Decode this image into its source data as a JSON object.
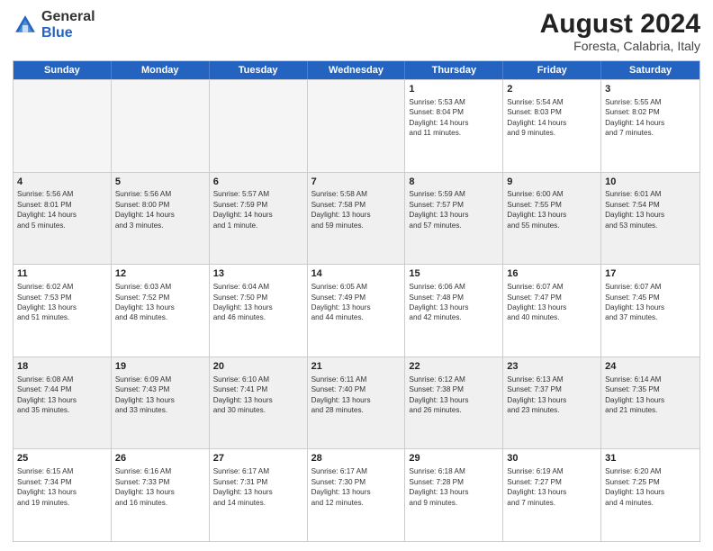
{
  "header": {
    "logo_general": "General",
    "logo_blue": "Blue",
    "title": "August 2024",
    "subtitle": "Foresta, Calabria, Italy"
  },
  "calendar": {
    "days_of_week": [
      "Sunday",
      "Monday",
      "Tuesday",
      "Wednesday",
      "Thursday",
      "Friday",
      "Saturday"
    ],
    "rows": [
      [
        {
          "day": "",
          "empty": true
        },
        {
          "day": "",
          "empty": true
        },
        {
          "day": "",
          "empty": true
        },
        {
          "day": "",
          "empty": true
        },
        {
          "day": "1",
          "lines": [
            "Sunrise: 5:53 AM",
            "Sunset: 8:04 PM",
            "Daylight: 14 hours",
            "and 11 minutes."
          ]
        },
        {
          "day": "2",
          "lines": [
            "Sunrise: 5:54 AM",
            "Sunset: 8:03 PM",
            "Daylight: 14 hours",
            "and 9 minutes."
          ]
        },
        {
          "day": "3",
          "lines": [
            "Sunrise: 5:55 AM",
            "Sunset: 8:02 PM",
            "Daylight: 14 hours",
            "and 7 minutes."
          ]
        }
      ],
      [
        {
          "day": "4",
          "lines": [
            "Sunrise: 5:56 AM",
            "Sunset: 8:01 PM",
            "Daylight: 14 hours",
            "and 5 minutes."
          ]
        },
        {
          "day": "5",
          "lines": [
            "Sunrise: 5:56 AM",
            "Sunset: 8:00 PM",
            "Daylight: 14 hours",
            "and 3 minutes."
          ]
        },
        {
          "day": "6",
          "lines": [
            "Sunrise: 5:57 AM",
            "Sunset: 7:59 PM",
            "Daylight: 14 hours",
            "and 1 minute."
          ]
        },
        {
          "day": "7",
          "lines": [
            "Sunrise: 5:58 AM",
            "Sunset: 7:58 PM",
            "Daylight: 13 hours",
            "and 59 minutes."
          ]
        },
        {
          "day": "8",
          "lines": [
            "Sunrise: 5:59 AM",
            "Sunset: 7:57 PM",
            "Daylight: 13 hours",
            "and 57 minutes."
          ]
        },
        {
          "day": "9",
          "lines": [
            "Sunrise: 6:00 AM",
            "Sunset: 7:55 PM",
            "Daylight: 13 hours",
            "and 55 minutes."
          ]
        },
        {
          "day": "10",
          "lines": [
            "Sunrise: 6:01 AM",
            "Sunset: 7:54 PM",
            "Daylight: 13 hours",
            "and 53 minutes."
          ]
        }
      ],
      [
        {
          "day": "11",
          "lines": [
            "Sunrise: 6:02 AM",
            "Sunset: 7:53 PM",
            "Daylight: 13 hours",
            "and 51 minutes."
          ]
        },
        {
          "day": "12",
          "lines": [
            "Sunrise: 6:03 AM",
            "Sunset: 7:52 PM",
            "Daylight: 13 hours",
            "and 48 minutes."
          ]
        },
        {
          "day": "13",
          "lines": [
            "Sunrise: 6:04 AM",
            "Sunset: 7:50 PM",
            "Daylight: 13 hours",
            "and 46 minutes."
          ]
        },
        {
          "day": "14",
          "lines": [
            "Sunrise: 6:05 AM",
            "Sunset: 7:49 PM",
            "Daylight: 13 hours",
            "and 44 minutes."
          ]
        },
        {
          "day": "15",
          "lines": [
            "Sunrise: 6:06 AM",
            "Sunset: 7:48 PM",
            "Daylight: 13 hours",
            "and 42 minutes."
          ]
        },
        {
          "day": "16",
          "lines": [
            "Sunrise: 6:07 AM",
            "Sunset: 7:47 PM",
            "Daylight: 13 hours",
            "and 40 minutes."
          ]
        },
        {
          "day": "17",
          "lines": [
            "Sunrise: 6:07 AM",
            "Sunset: 7:45 PM",
            "Daylight: 13 hours",
            "and 37 minutes."
          ]
        }
      ],
      [
        {
          "day": "18",
          "lines": [
            "Sunrise: 6:08 AM",
            "Sunset: 7:44 PM",
            "Daylight: 13 hours",
            "and 35 minutes."
          ]
        },
        {
          "day": "19",
          "lines": [
            "Sunrise: 6:09 AM",
            "Sunset: 7:43 PM",
            "Daylight: 13 hours",
            "and 33 minutes."
          ]
        },
        {
          "day": "20",
          "lines": [
            "Sunrise: 6:10 AM",
            "Sunset: 7:41 PM",
            "Daylight: 13 hours",
            "and 30 minutes."
          ]
        },
        {
          "day": "21",
          "lines": [
            "Sunrise: 6:11 AM",
            "Sunset: 7:40 PM",
            "Daylight: 13 hours",
            "and 28 minutes."
          ]
        },
        {
          "day": "22",
          "lines": [
            "Sunrise: 6:12 AM",
            "Sunset: 7:38 PM",
            "Daylight: 13 hours",
            "and 26 minutes."
          ]
        },
        {
          "day": "23",
          "lines": [
            "Sunrise: 6:13 AM",
            "Sunset: 7:37 PM",
            "Daylight: 13 hours",
            "and 23 minutes."
          ]
        },
        {
          "day": "24",
          "lines": [
            "Sunrise: 6:14 AM",
            "Sunset: 7:35 PM",
            "Daylight: 13 hours",
            "and 21 minutes."
          ]
        }
      ],
      [
        {
          "day": "25",
          "lines": [
            "Sunrise: 6:15 AM",
            "Sunset: 7:34 PM",
            "Daylight: 13 hours",
            "and 19 minutes."
          ]
        },
        {
          "day": "26",
          "lines": [
            "Sunrise: 6:16 AM",
            "Sunset: 7:33 PM",
            "Daylight: 13 hours",
            "and 16 minutes."
          ]
        },
        {
          "day": "27",
          "lines": [
            "Sunrise: 6:17 AM",
            "Sunset: 7:31 PM",
            "Daylight: 13 hours",
            "and 14 minutes."
          ]
        },
        {
          "day": "28",
          "lines": [
            "Sunrise: 6:17 AM",
            "Sunset: 7:30 PM",
            "Daylight: 13 hours",
            "and 12 minutes."
          ]
        },
        {
          "day": "29",
          "lines": [
            "Sunrise: 6:18 AM",
            "Sunset: 7:28 PM",
            "Daylight: 13 hours",
            "and 9 minutes."
          ]
        },
        {
          "day": "30",
          "lines": [
            "Sunrise: 6:19 AM",
            "Sunset: 7:27 PM",
            "Daylight: 13 hours",
            "and 7 minutes."
          ]
        },
        {
          "day": "31",
          "lines": [
            "Sunrise: 6:20 AM",
            "Sunset: 7:25 PM",
            "Daylight: 13 hours",
            "and 4 minutes."
          ]
        }
      ]
    ]
  }
}
